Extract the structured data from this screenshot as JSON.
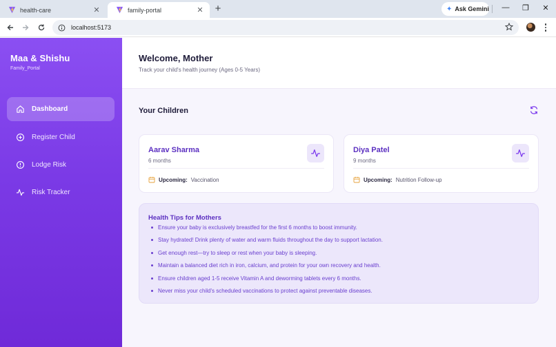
{
  "browser": {
    "tabs": [
      {
        "title": "health-care",
        "active": false
      },
      {
        "title": "family-portal",
        "active": true
      }
    ],
    "new_tab": "+",
    "ask_gemini": "Ask Gemini",
    "url": "localhost:5173"
  },
  "sidebar": {
    "brand": "Maa & Shishu",
    "subtitle": "Family_Portal",
    "items": [
      {
        "label": "Dashboard",
        "icon": "home-icon",
        "active": true
      },
      {
        "label": "Register Child",
        "icon": "plus-circle-icon",
        "active": false
      },
      {
        "label": "Lodge Risk",
        "icon": "alert-circle-icon",
        "active": false
      },
      {
        "label": "Risk Tracker",
        "icon": "activity-icon",
        "active": false
      }
    ]
  },
  "header": {
    "title": "Welcome, Mother",
    "subtitle": "Track your child's health journey (Ages 0-5 Years)"
  },
  "children_section": {
    "title": "Your Children",
    "children": [
      {
        "name": "Aarav Sharma",
        "age": "6 months",
        "upcoming_label": "Upcoming:",
        "upcoming_value": "Vaccination"
      },
      {
        "name": "Diya Patel",
        "age": "9 months",
        "upcoming_label": "Upcoming:",
        "upcoming_value": "Nutrition Follow-up"
      }
    ]
  },
  "health_tips": {
    "title": "Health Tips for Mothers",
    "tips": [
      "Ensure your baby is exclusively breastfed for the first 6 months to boost immunity.",
      "Stay hydrated! Drink plenty of water and warm fluids throughout the day to support lactation.",
      "Get enough rest—try to sleep or rest when your baby is sleeping.",
      "Maintain a balanced diet rich in iron, calcium, and protein for your own recovery and health.",
      "Ensure children aged 1-5 receive Vitamin A and deworming tablets every 6 months.",
      "Never miss your child's scheduled vaccinations to protect against preventable diseases."
    ]
  },
  "colors": {
    "accent": "#7c3aed",
    "accent_text": "#5b2fc0",
    "calendar": "#e6a23c"
  }
}
